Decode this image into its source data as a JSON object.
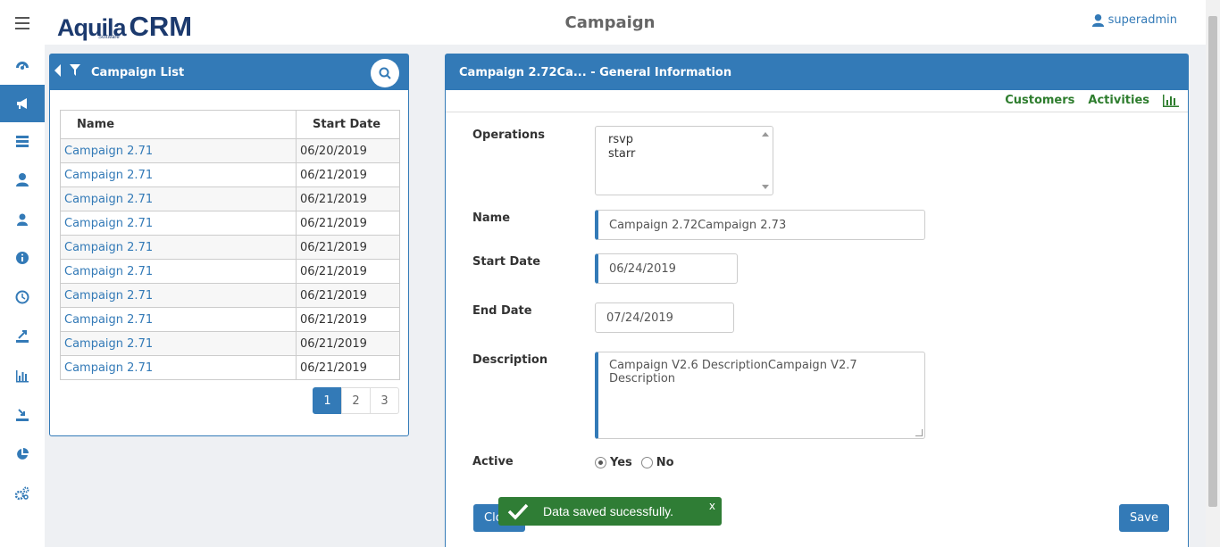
{
  "header": {
    "logo_aquila": "Aquila",
    "logo_crm": "CRM",
    "logo_software": "Software",
    "title": "Campaign",
    "user": "superadmin"
  },
  "sidebar": {
    "items": [
      {
        "icon": "dashboard-icon"
      },
      {
        "icon": "megaphone-icon",
        "active": true
      },
      {
        "icon": "list-icon"
      },
      {
        "icon": "user-icon"
      },
      {
        "icon": "contact-icon"
      },
      {
        "icon": "info-icon"
      },
      {
        "icon": "clock-icon"
      },
      {
        "icon": "export-icon"
      },
      {
        "icon": "bar-chart-icon"
      },
      {
        "icon": "import-icon"
      },
      {
        "icon": "pie-chart-icon"
      },
      {
        "icon": "settings-icon"
      }
    ]
  },
  "list_panel": {
    "title": "Campaign List",
    "columns": [
      "Name",
      "Start Date"
    ],
    "rows": [
      {
        "name": "Campaign 2.71",
        "date": "06/20/2019"
      },
      {
        "name": "Campaign 2.71",
        "date": "06/21/2019"
      },
      {
        "name": "Campaign 2.71",
        "date": "06/21/2019"
      },
      {
        "name": "Campaign 2.71",
        "date": "06/21/2019"
      },
      {
        "name": "Campaign 2.71",
        "date": "06/21/2019"
      },
      {
        "name": "Campaign 2.71",
        "date": "06/21/2019"
      },
      {
        "name": "Campaign 2.71",
        "date": "06/21/2019"
      },
      {
        "name": "Campaign 2.71",
        "date": "06/21/2019"
      },
      {
        "name": "Campaign 2.71",
        "date": "06/21/2019"
      },
      {
        "name": "Campaign 2.71",
        "date": "06/21/2019"
      }
    ],
    "pages": [
      "1",
      "2",
      "3"
    ],
    "current_page": "1"
  },
  "info_panel": {
    "title": "Campaign 2.72Ca... - General Information",
    "tabs": [
      "Customers",
      "Activities"
    ],
    "labels": {
      "operations": "Operations",
      "name": "Name",
      "start_date": "Start Date",
      "end_date": "End Date",
      "description": "Description",
      "active": "Active"
    },
    "operations": [
      "rsvp",
      "starr"
    ],
    "name_value": "Campaign 2.72Campaign 2.73",
    "start_date_value": "06/24/2019",
    "end_date_value": "07/24/2019",
    "description_value": "Campaign V2.6 DescriptionCampaign V2.7 Description",
    "active_yes": "Yes",
    "active_no": "No",
    "active_selected": "Yes",
    "close_label": "Close",
    "save_label": "Save"
  },
  "toast": {
    "message": "Data saved sucessfully.",
    "close": "x"
  },
  "colors": {
    "primary": "#337ab7",
    "success": "#2f7d35",
    "tab_green": "#2e7d2e"
  }
}
